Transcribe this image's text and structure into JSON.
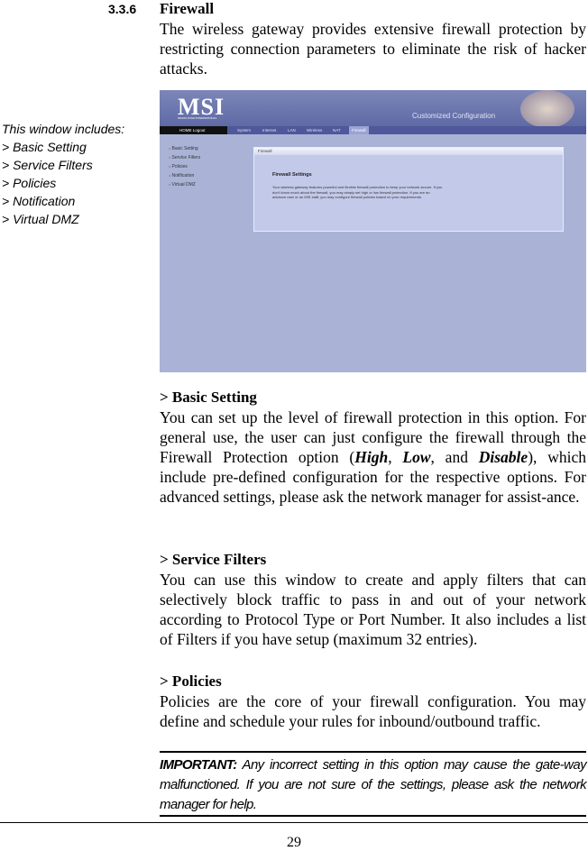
{
  "section": {
    "number": "3.3.6",
    "title": "Firewall",
    "intro": "The wireless gateway provides extensive firewall protection by restricting connection parameters to eliminate the risk of hacker attacks."
  },
  "sidebar": {
    "heading": "This window includes:",
    "items": [
      "> Basic Setting",
      "> Service Filters",
      "> Policies",
      "> Notification",
      "> Virtual DMZ"
    ]
  },
  "screenshot": {
    "logo": "MSI",
    "logo_sub": "MICRO-STAR INTERNATIONAL",
    "banner_title": "Customized Configuration",
    "nav_left": "HOME  Logout",
    "tabs": [
      "System",
      "Internet",
      "LAN",
      "Wireless",
      "NAT",
      "Firewall"
    ],
    "active_tab": "Firewall",
    "menu": [
      "Basic Setting",
      "Service Filters",
      "Policies",
      "Notification",
      "Virtual DMZ"
    ],
    "panel_title": "Firewall",
    "settings_title": "Firewall Settings",
    "settings_text": "Your wireless gateway features powerful and flexible firewall protection to keep your network secure. If you don't know much about the firewall, you may simply set high or low firewall protection. If you are an advance user or an MIS staff, you may configure firewall policies based on your requirements."
  },
  "basic": {
    "heading": "> Basic Setting",
    "t1": "You can set up the level of firewall protection in this option. For general use, the user can just configure the firewall through the Firewall Protection option (",
    "high": "High",
    "sep1": ", ",
    "low": "Low",
    "sep2": ", and ",
    "disable": "Disable",
    "t2": "), which include pre-defined configuration for the respective options. For advanced settings, please ask the network manager for assist-ance."
  },
  "filters": {
    "heading": "> Service Filters",
    "text": "You can use this window to create and apply filters that can selectively block traffic to pass in and out of your network according to Protocol Type or Port Number.  It also includes a list of Filters if you have setup (maximum 32 entries)."
  },
  "policies": {
    "heading": "> Policies",
    "text": "Policies are the core of your firewall configuration.  You may define and schedule your rules for inbound/outbound traffic."
  },
  "important": {
    "label": "IMPORTANT:",
    "text": " Any incorrect setting in this option may cause the gate-way malfunctioned.  If you are not sure of the settings, please ask the network manager for help."
  },
  "page_number": "29"
}
